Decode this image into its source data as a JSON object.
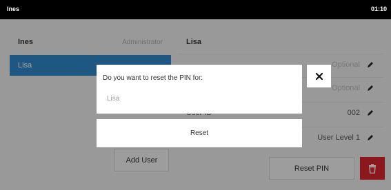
{
  "statusbar": {
    "user": "Ines",
    "time": "01:10"
  },
  "users_panel": {
    "rows": [
      {
        "name": "Ines",
        "role": "Administrator"
      },
      {
        "name": "Lisa",
        "role": ""
      }
    ],
    "add_button": "Add User"
  },
  "details": {
    "name": "Lisa",
    "rows": [
      {
        "label": "",
        "value": "Optional"
      },
      {
        "label": "",
        "value": "Optional"
      },
      {
        "label": "User ID",
        "value": "002"
      },
      {
        "label": "",
        "value": "User Level 1"
      }
    ],
    "reset_pin_button": "Reset PIN"
  },
  "dialog": {
    "question": "Do you want to reset the PIN for:",
    "target": "Lisa",
    "reset_button": "Reset"
  },
  "colors": {
    "accent": "#2f87c8",
    "danger": "#d8242b"
  }
}
